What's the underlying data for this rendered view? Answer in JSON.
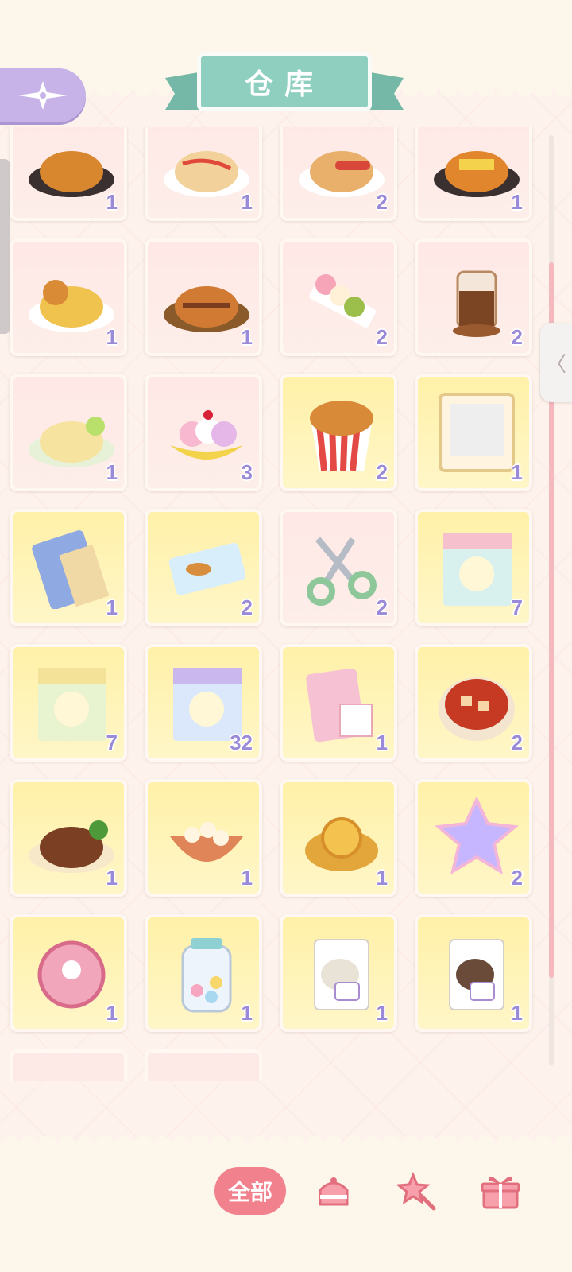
{
  "header": {
    "title": "仓库"
  },
  "inventory": {
    "items": [
      {
        "name": "fried-chicken-plate",
        "count": "1",
        "bg": "pink"
      },
      {
        "name": "omelette-rice",
        "count": "1",
        "bg": "pink"
      },
      {
        "name": "sausage-breakfast",
        "count": "2",
        "bg": "pink"
      },
      {
        "name": "cheese-toast",
        "count": "1",
        "bg": "pink"
      },
      {
        "name": "burger-platter",
        "count": "1",
        "bg": "pink"
      },
      {
        "name": "katsu-plate",
        "count": "1",
        "bg": "pink"
      },
      {
        "name": "dango-skewer",
        "count": "2",
        "bg": "pink"
      },
      {
        "name": "iced-coffee",
        "count": "2",
        "bg": "pink"
      },
      {
        "name": "lime-cheesecake",
        "count": "1",
        "bg": "pink"
      },
      {
        "name": "banana-split",
        "count": "3",
        "bg": "pink"
      },
      {
        "name": "fried-chicken-bucket",
        "count": "2",
        "bg": "yellow"
      },
      {
        "name": "photo-frame",
        "count": "1",
        "bg": "yellow"
      },
      {
        "name": "blue-book",
        "count": "1",
        "bg": "yellow"
      },
      {
        "name": "taiyaki-ticket",
        "count": "2",
        "bg": "yellow"
      },
      {
        "name": "scissors",
        "count": "2",
        "bg": "pink"
      },
      {
        "name": "strawberry-sticker-pack",
        "count": "7",
        "bg": "yellow"
      },
      {
        "name": "souffle-sticker-pack",
        "count": "7",
        "bg": "yellow"
      },
      {
        "name": "blueberry-sticker-pack",
        "count": "32",
        "bg": "yellow"
      },
      {
        "name": "photo-card-pack",
        "count": "1",
        "bg": "yellow"
      },
      {
        "name": "mapo-tofu",
        "count": "2",
        "bg": "yellow"
      },
      {
        "name": "steak-dinner",
        "count": "1",
        "bg": "yellow"
      },
      {
        "name": "fishball-soup",
        "count": "1",
        "bg": "yellow"
      },
      {
        "name": "gold-coins",
        "count": "1",
        "bg": "yellow"
      },
      {
        "name": "rainbow-crystal",
        "count": "2",
        "bg": "yellow"
      },
      {
        "name": "pink-badge",
        "count": "1",
        "bg": "yellow"
      },
      {
        "name": "candy-jar",
        "count": "1",
        "bg": "yellow"
      },
      {
        "name": "white-powder-bag",
        "count": "1",
        "bg": "yellow"
      },
      {
        "name": "cocoa-powder-bag",
        "count": "1",
        "bg": "yellow"
      }
    ]
  },
  "tabs": {
    "all_label": "全部",
    "cake_icon": "cake-icon",
    "wand_icon": "wand-icon",
    "gift_icon": "gift-box-icon"
  },
  "colors": {
    "accent_pink": "#f2818e",
    "count_purple": "#9a8ad8",
    "title_teal": "#8fcfbf",
    "back_purple": "#c7b3e8"
  }
}
